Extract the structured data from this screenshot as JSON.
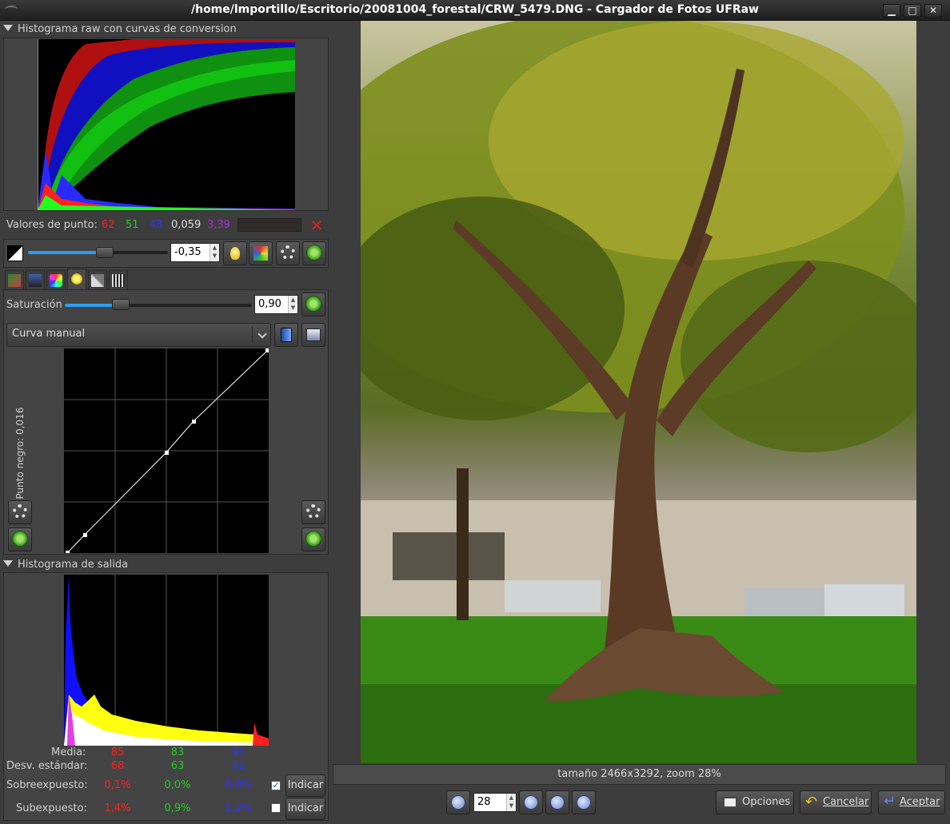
{
  "window": {
    "title": "/home/lmportillo/Escritorio/20081004_forestal/CRW_5479.DNG - Cargador de Fotos UFRaw"
  },
  "raw_histogram": {
    "header": "Histograma raw con curvas de conversion"
  },
  "point_values": {
    "label": "Valores de punto:",
    "r": "62",
    "g": "51",
    "b": "48",
    "lum": "0,059",
    "ev": "3,39"
  },
  "exposure": {
    "value": "-0,35",
    "level": 0.55
  },
  "saturation": {
    "label": "Saturación",
    "value": "0,90",
    "level": 0.3
  },
  "curve": {
    "selected": "Curva manual",
    "black_point_label": "Punto negro: 0,016"
  },
  "output_histogram": {
    "header": "Histograma de salida"
  },
  "stats": {
    "media_label": "Media:",
    "desv_label": "Desv. estándar:",
    "sobre_label": "Sobreexpuesto:",
    "sub_label": "Subexpuesto:",
    "media": [
      "85",
      "83",
      "45"
    ],
    "desv": [
      "68",
      "63",
      "52"
    ],
    "sobre": [
      "0,1%",
      "0,0%",
      "0,0%"
    ],
    "sub": [
      "1,4%",
      "0,9%",
      "1,2%"
    ],
    "indicar": "Indicar"
  },
  "preview": {
    "status": "tamaño 2466x3292, zoom 28%"
  },
  "zoom": {
    "value": "28"
  },
  "actions": {
    "opciones": "Opciones",
    "cancelar": "Cancelar",
    "aceptar": "Aceptar"
  },
  "colors": {
    "red": "#ff2020",
    "green": "#20e020",
    "blue": "#2020ff",
    "purple": "#b030e0"
  }
}
